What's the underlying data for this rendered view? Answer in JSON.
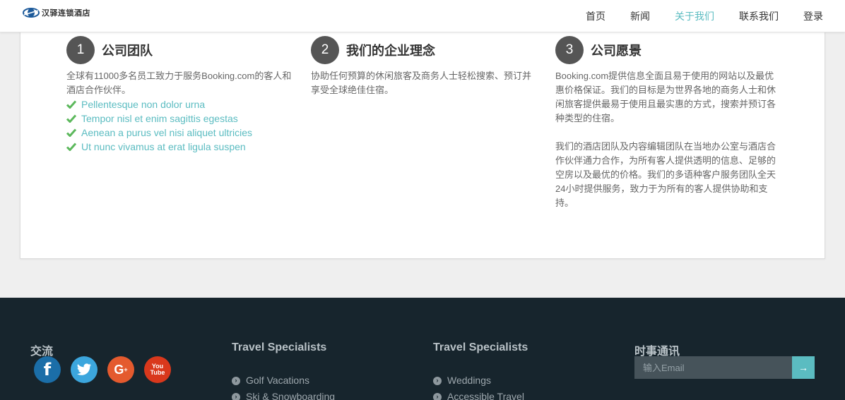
{
  "header": {
    "logo_text": "汉驿连锁酒店",
    "nav": [
      "首页",
      "新闻",
      "关于我们",
      "联系我们",
      "登录"
    ],
    "active_nav": "关于我们"
  },
  "sections": [
    {
      "number": "1",
      "title": "公司团队",
      "paragraphs": [
        "全球有11000多名员工致力于服务Booking.com的客人和酒店合作伙伴。"
      ],
      "checklist": [
        "Pellentesque non dolor urna",
        "Tempor nisl et enim sagittis egestas",
        "Aenean a purus vel nisi aliquet ultricies",
        "Ut nunc vivamus at erat ligula suspen"
      ]
    },
    {
      "number": "2",
      "title": "我们的企业理念",
      "paragraphs": [
        "协助任何预算的休闲旅客及商务人士轻松搜索、预订并享受全球绝佳住宿。"
      ]
    },
    {
      "number": "3",
      "title": "公司愿景",
      "paragraphs": [
        "Booking.com提供信息全面且易于使用的网站以及最优惠价格保证。我们的目标是为世界各地的商务人士和休闲旅客提供最易于使用且最实惠的方式，搜索并预订各种类型的住宿。",
        "我们的酒店团队及内容编辑团队在当地办公室与酒店合作伙伴通力合作，为所有客人提供透明的信息、足够的空房以及最优的价格。我们的多语种客户服务团队全天24小时提供服务，致力于为所有的客人提供协助和支持。"
      ]
    }
  ],
  "footer": {
    "social_title": "交流",
    "social_icons": [
      "facebook-icon",
      "twitter-icon",
      "google-plus-icon",
      "youtube-icon"
    ],
    "col2_title": "Travel Specialists",
    "col2_links": [
      "Golf Vacations",
      "Ski & Snowboarding"
    ],
    "col3_title": "Travel Specialists",
    "col3_links": [
      "Weddings",
      "Accessible Travel"
    ],
    "newsletter_title": "时事通讯",
    "email_placeholder": "输入Email"
  },
  "colors": {
    "accent": "#5bbcc1",
    "footer_bg": "#17252d",
    "circle_bg": "#555555",
    "check_green": "#5cb85c"
  }
}
